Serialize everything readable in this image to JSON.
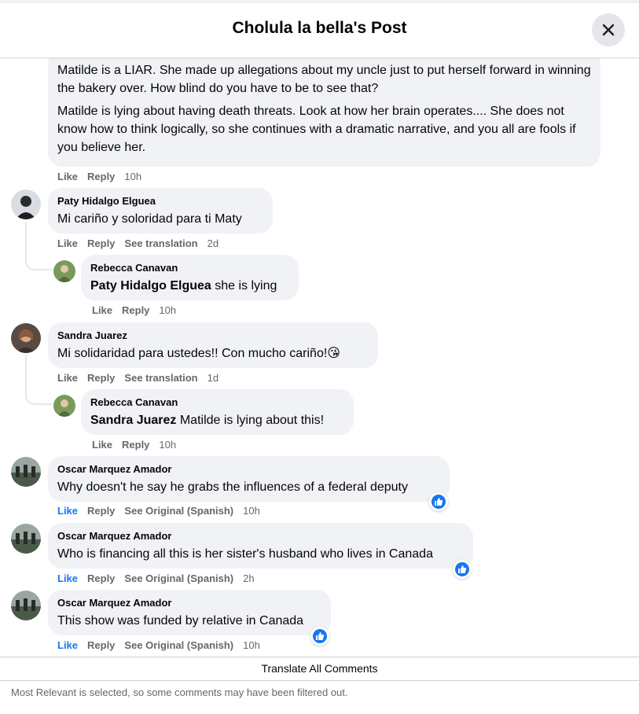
{
  "header": {
    "title": "Cholula la bella's Post",
    "close_icon": "close-icon"
  },
  "first_comment": {
    "paragraphs": [
      "Matilde is a LIAR. She made up allegations about my uncle just to put herself forward in winning the bakery over. How blind do you have to be to see that?",
      "Matilde is lying about having death threats. Look at how her brain operates.... She does not know how to think logically, so she continues with a dramatic narrative, and you all are fools if you believe her."
    ],
    "actions": {
      "like": "Like",
      "reply": "Reply",
      "time": "10h"
    }
  },
  "comments": [
    {
      "author": "Paty Hidalgo Elguea",
      "text": "Mi cariño y soloridad para ti Maty",
      "actions": {
        "like": "Like",
        "reply": "Reply",
        "extra": "See translation",
        "time": "2d"
      }
    },
    {
      "author": "Rebecca Canavan",
      "mention": "Paty Hidalgo Elguea",
      "text": " she is lying",
      "actions": {
        "like": "Like",
        "reply": "Reply",
        "time": "10h"
      }
    },
    {
      "author": "Sandra Juarez",
      "text": "Mi solidaridad para ustedes!! Con mucho cariño!😘",
      "actions": {
        "like": "Like",
        "reply": "Reply",
        "extra": "See translation",
        "time": "1d"
      }
    },
    {
      "author": "Rebecca Canavan",
      "mention": "Sandra Juarez",
      "text": " Matilde is lying about this!",
      "actions": {
        "like": "Like",
        "reply": "Reply",
        "time": "10h"
      }
    },
    {
      "author": "Oscar Marquez Amador",
      "text": "Why doesn't he say he grabs the influences of a federal deputy",
      "actions": {
        "like": "Like",
        "reply": "Reply",
        "extra": "See Original (Spanish)",
        "time": "10h"
      }
    },
    {
      "author": "Oscar Marquez Amador",
      "text": "Who is financing all this is her sister's husband who lives in Canada",
      "actions": {
        "like": "Like",
        "reply": "Reply",
        "extra": "See Original (Spanish)",
        "time": "2h"
      }
    },
    {
      "author": "Oscar Marquez Amador",
      "text": "This show was funded by relative in Canada",
      "actions": {
        "like": "Like",
        "reply": "Reply",
        "extra": "See Original (Spanish)",
        "time": "10h"
      }
    }
  ],
  "translate_all": "Translate All Comments",
  "footer_note": "Most Relevant is selected, so some comments may have been filtered out.",
  "colors": {
    "accent": "#1877f2",
    "bubble": "#f0f2f5",
    "muted_text": "#65676b"
  }
}
